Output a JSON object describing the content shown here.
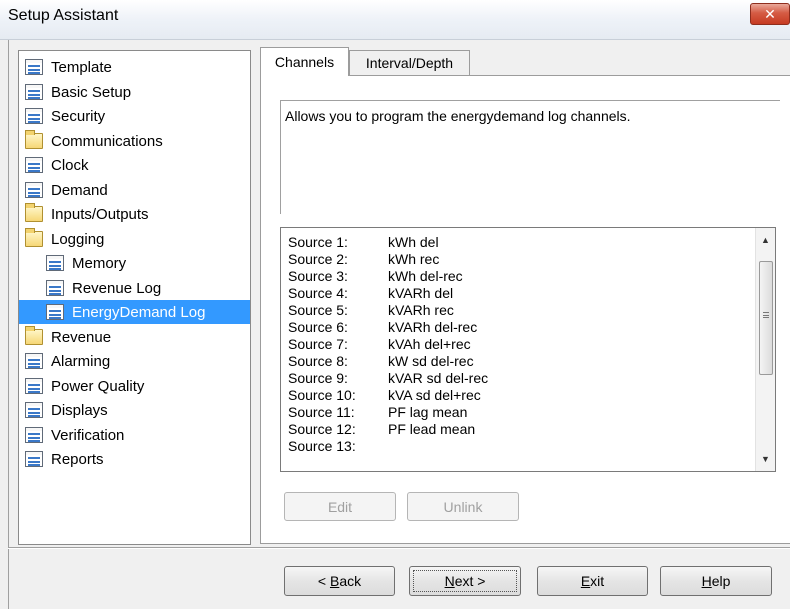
{
  "window": {
    "title": "Setup Assistant",
    "close_label": "✕"
  },
  "tree": {
    "items": [
      {
        "label": "Template",
        "icon": "doc",
        "indent": 0
      },
      {
        "label": "Basic Setup",
        "icon": "doc",
        "indent": 0
      },
      {
        "label": "Security",
        "icon": "doc",
        "indent": 0
      },
      {
        "label": "Communications",
        "icon": "folder",
        "indent": 0
      },
      {
        "label": "Clock",
        "icon": "doc",
        "indent": 0
      },
      {
        "label": "Demand",
        "icon": "doc",
        "indent": 0
      },
      {
        "label": "Inputs/Outputs",
        "icon": "folder",
        "indent": 0
      },
      {
        "label": "Logging",
        "icon": "folder",
        "indent": 0
      },
      {
        "label": "Memory",
        "icon": "doc",
        "indent": 1
      },
      {
        "label": "Revenue Log",
        "icon": "doc",
        "indent": 1
      },
      {
        "label": "EnergyDemand Log",
        "icon": "doc",
        "indent": 1,
        "selected": true
      },
      {
        "label": "Revenue",
        "icon": "folder",
        "indent": 0
      },
      {
        "label": "Alarming",
        "icon": "doc",
        "indent": 0
      },
      {
        "label": "Power Quality",
        "icon": "doc",
        "indent": 0
      },
      {
        "label": "Displays",
        "icon": "doc",
        "indent": 0
      },
      {
        "label": "Verification",
        "icon": "doc",
        "indent": 0
      },
      {
        "label": "Reports",
        "icon": "doc",
        "indent": 0
      }
    ]
  },
  "tabs": [
    {
      "label": "Channels",
      "active": true
    },
    {
      "label": "Interval/Depth",
      "active": false
    }
  ],
  "description": "Allows you to program the energydemand log channels.",
  "channels": [
    {
      "source": "Source 1:",
      "value": "kWh del"
    },
    {
      "source": "Source 2:",
      "value": "kWh rec"
    },
    {
      "source": "Source 3:",
      "value": "kWh del-rec"
    },
    {
      "source": "Source 4:",
      "value": "kVARh del"
    },
    {
      "source": "Source 5:",
      "value": "kVARh rec"
    },
    {
      "source": "Source 6:",
      "value": "kVARh del-rec"
    },
    {
      "source": "Source 7:",
      "value": "kVAh del+rec"
    },
    {
      "source": "Source 8:",
      "value": "kW sd del-rec"
    },
    {
      "source": "Source 9:",
      "value": "kVAR sd del-rec"
    },
    {
      "source": "Source 10:",
      "value": "kVA sd del+rec"
    },
    {
      "source": "Source 11:",
      "value": "PF lag mean"
    },
    {
      "source": "Source 12:",
      "value": "PF lead mean"
    },
    {
      "source": "Source 13:",
      "value": ""
    }
  ],
  "list_buttons": {
    "edit": "Edit",
    "unlink": "Unlink"
  },
  "nav_buttons": {
    "back_prefix": "< ",
    "back_key": "B",
    "back_rest": "ack",
    "next_key": "N",
    "next_rest": "ext >",
    "exit_key": "E",
    "exit_rest": "xit",
    "help_key": "H",
    "help_rest": "elp"
  },
  "colors": {
    "selection": "#3399ff",
    "close_button": "#c63a22"
  }
}
